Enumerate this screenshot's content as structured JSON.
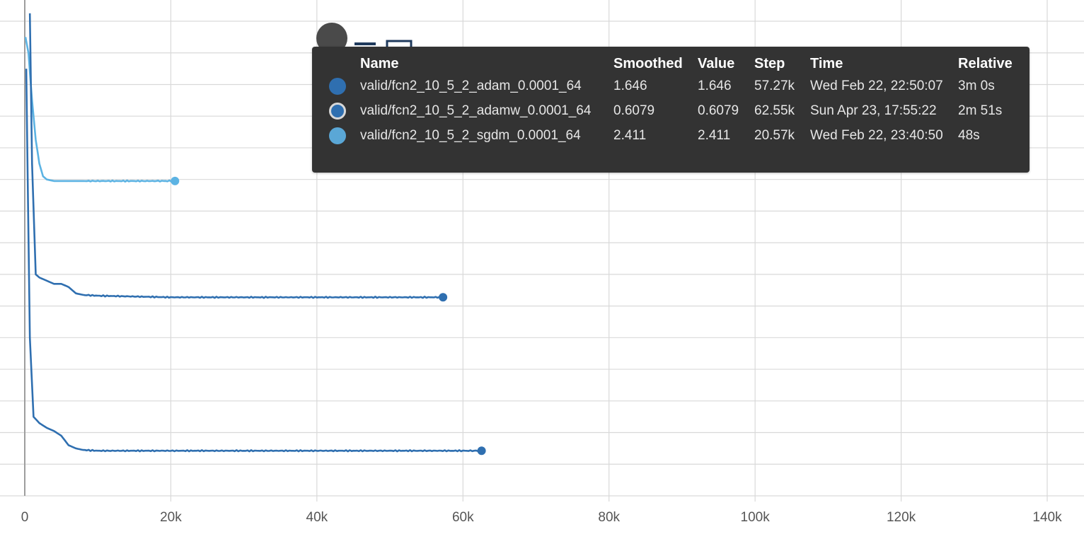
{
  "chart_data": {
    "type": "line",
    "title": "",
    "xlabel": "",
    "ylabel": "",
    "xlim": [
      0,
      140000
    ],
    "x_ticks": [
      0,
      20000,
      40000,
      60000,
      80000,
      100000,
      120000,
      140000
    ],
    "x_tick_labels": [
      "0",
      "20k",
      "40k",
      "60k",
      "80k",
      "100k",
      "120k",
      "140k"
    ],
    "ylim": [
      0,
      3.0
    ],
    "y_gridlines": 15,
    "grid": true,
    "y_tick_labels_visible": false,
    "series": [
      {
        "name": "valid/fcn2_10_5_2_adam_0.0001_64",
        "color": "#2f6fb0",
        "points": [
          [
            700,
            3.05
          ],
          [
            1000,
            2.1
          ],
          [
            1500,
            1.4
          ],
          [
            2000,
            1.38
          ],
          [
            3000,
            1.36
          ],
          [
            4000,
            1.34
          ],
          [
            5000,
            1.34
          ],
          [
            6000,
            1.32
          ],
          [
            7000,
            1.28
          ],
          [
            8000,
            1.27
          ],
          [
            10000,
            1.265
          ],
          [
            15000,
            1.26
          ],
          [
            20000,
            1.255
          ],
          [
            25000,
            1.255
          ],
          [
            30000,
            1.255
          ],
          [
            35000,
            1.255
          ],
          [
            40000,
            1.255
          ],
          [
            45000,
            1.255
          ],
          [
            50000,
            1.255
          ],
          [
            55000,
            1.255
          ],
          [
            57270,
            1.255
          ]
        ]
      },
      {
        "name": "valid/fcn2_10_5_2_adamw_0.0001_64",
        "color": "#2f6fb0",
        "points": [
          [
            200,
            2.7
          ],
          [
            700,
            1.0
          ],
          [
            1200,
            0.5
          ],
          [
            2000,
            0.46
          ],
          [
            3000,
            0.43
          ],
          [
            4000,
            0.41
          ],
          [
            5000,
            0.38
          ],
          [
            6000,
            0.32
          ],
          [
            7000,
            0.3
          ],
          [
            8000,
            0.29
          ],
          [
            10000,
            0.285
          ],
          [
            15000,
            0.285
          ],
          [
            20000,
            0.285
          ],
          [
            30000,
            0.285
          ],
          [
            40000,
            0.285
          ],
          [
            50000,
            0.285
          ],
          [
            60000,
            0.285
          ],
          [
            62550,
            0.285
          ]
        ]
      },
      {
        "name": "valid/fcn2_10_5_2_sgdm_0.0001_64",
        "color": "#5cb3e3",
        "points": [
          [
            100,
            2.9
          ],
          [
            500,
            2.8
          ],
          [
            1000,
            2.5
          ],
          [
            1500,
            2.25
          ],
          [
            2000,
            2.1
          ],
          [
            2500,
            2.02
          ],
          [
            3000,
            2.0
          ],
          [
            4000,
            1.99
          ],
          [
            6000,
            1.99
          ],
          [
            8000,
            1.99
          ],
          [
            10000,
            1.99
          ],
          [
            12000,
            1.99
          ],
          [
            14000,
            1.99
          ],
          [
            16000,
            1.99
          ],
          [
            18000,
            1.99
          ],
          [
            20570,
            1.99
          ]
        ]
      }
    ]
  },
  "tooltip": {
    "headers": {
      "name": "Name",
      "smoothed": "Smoothed",
      "value": "Value",
      "step": "Step",
      "time": "Time",
      "relative": "Relative"
    },
    "rows": [
      {
        "swatch_color": "#2f6fb0",
        "swatch_style": "filled",
        "name": "valid/fcn2_10_5_2_adam_0.0001_64",
        "smoothed": "1.646",
        "value": "1.646",
        "step": "57.27k",
        "time": "Wed Feb 22, 22:50:07",
        "relative": "3m 0s"
      },
      {
        "swatch_color": "#2f6fb0",
        "swatch_style": "ring",
        "name": "valid/fcn2_10_5_2_adamw_0.0001_64",
        "smoothed": "0.6079",
        "value": "0.6079",
        "step": "62.55k",
        "time": "Sun Apr 23, 17:55:22",
        "relative": "2m 51s"
      },
      {
        "swatch_color": "#5aa7d6",
        "swatch_style": "filled",
        "name": "valid/fcn2_10_5_2_sgdm_0.0001_64",
        "smoothed": "2.411",
        "value": "2.411",
        "step": "20.57k",
        "time": "Wed Feb 22, 23:40:50",
        "relative": "48s"
      }
    ]
  }
}
